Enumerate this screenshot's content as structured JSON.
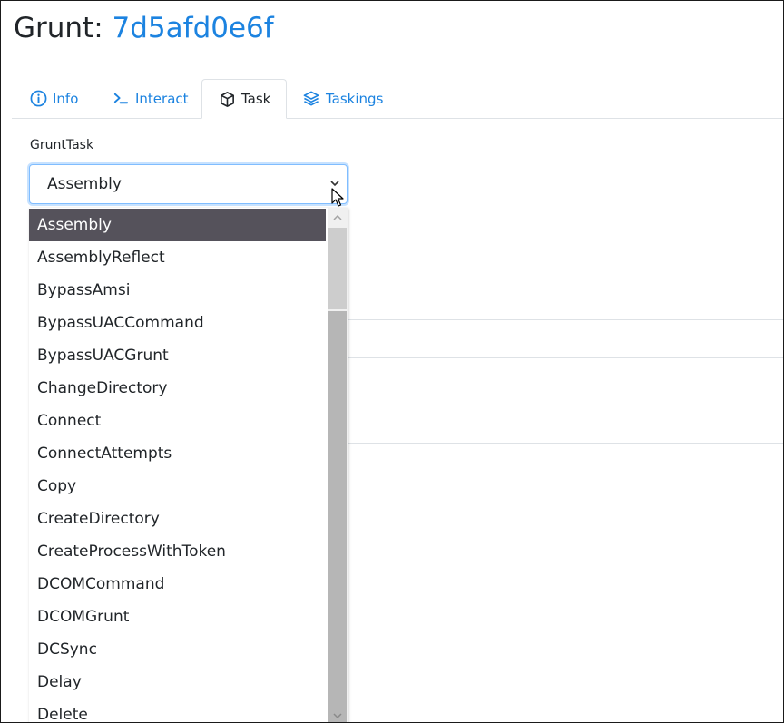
{
  "header": {
    "title_prefix": "Grunt:",
    "grunt_name": "7d5afd0e6f"
  },
  "tabs": [
    {
      "label": "Info",
      "icon": "info-icon",
      "active": false
    },
    {
      "label": "Interact",
      "icon": "terminal-icon",
      "active": false
    },
    {
      "label": "Task",
      "icon": "cube-icon",
      "active": true
    },
    {
      "label": "Taskings",
      "icon": "layers-icon",
      "active": false
    }
  ],
  "task_form": {
    "label": "GruntTask",
    "selected_value": "Assembly"
  },
  "dropdown_options": [
    "Assembly",
    "AssemblyReflect",
    "BypassAmsi",
    "BypassUACCommand",
    "BypassUACGrunt",
    "ChangeDirectory",
    "Connect",
    "ConnectAttempts",
    "Copy",
    "CreateDirectory",
    "CreateProcessWithToken",
    "DCOMCommand",
    "DCOMGrunt",
    "DCSync",
    "Delay",
    "Delete"
  ],
  "selected_index": 0,
  "colors": {
    "link_blue": "#1c83e0",
    "selected_option_bg": "#55525b",
    "focus_border": "#80bdff"
  }
}
